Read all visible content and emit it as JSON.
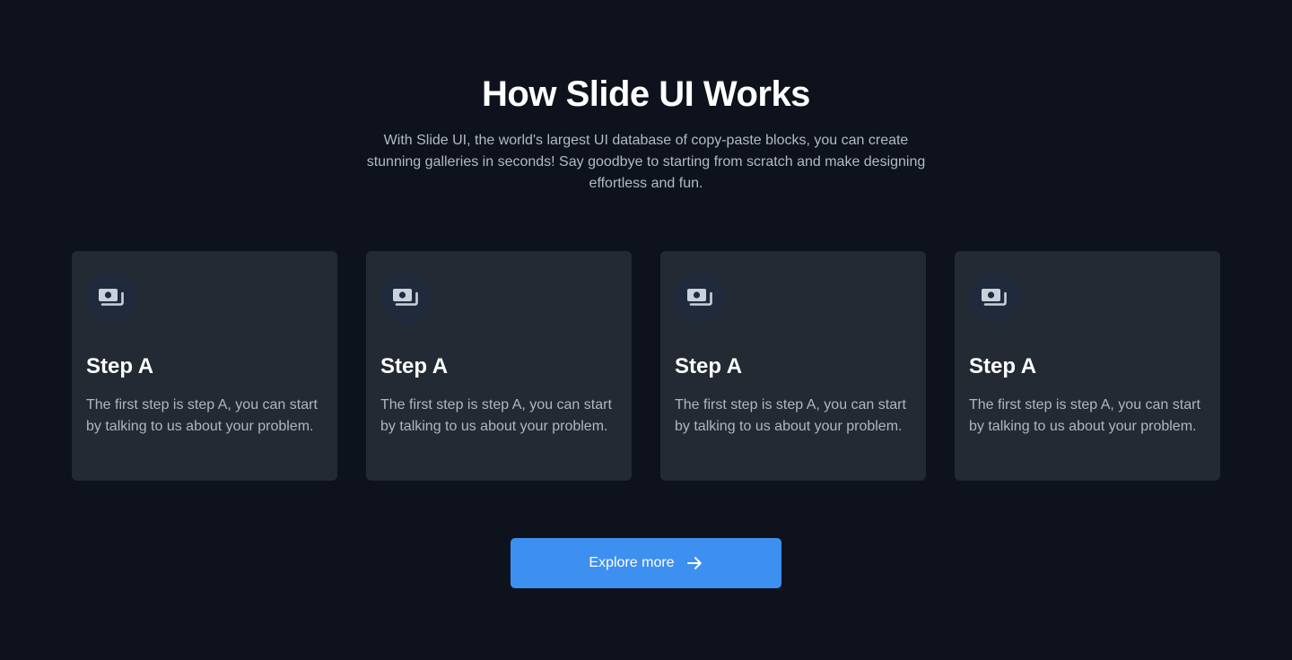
{
  "header": {
    "title": "How Slide UI Works",
    "subtitle": "With Slide UI, the world's largest UI database of copy-paste blocks, you can create stunning galleries in seconds! Say goodbye to starting from scratch and make designing effortless and fun."
  },
  "steps": [
    {
      "icon": "money-icon",
      "title": "Step A",
      "text": "The first step is step A, you can start by talking to us about your problem."
    },
    {
      "icon": "money-icon",
      "title": "Step A",
      "text": "The first step is step A, you can start by talking to us about your problem."
    },
    {
      "icon": "money-icon",
      "title": "Step A",
      "text": "The first step is step A, you can start by talking to us about your problem."
    },
    {
      "icon": "money-icon",
      "title": "Step A",
      "text": "The first step is step A, you can start by talking to us about your problem."
    }
  ],
  "cta": {
    "label": "Explore more",
    "icon": "arrow-right-icon"
  },
  "colors": {
    "background": "#0d121c",
    "card": "#232a33",
    "icon_circle": "#1f2b3c",
    "accent": "#3d90f0"
  }
}
